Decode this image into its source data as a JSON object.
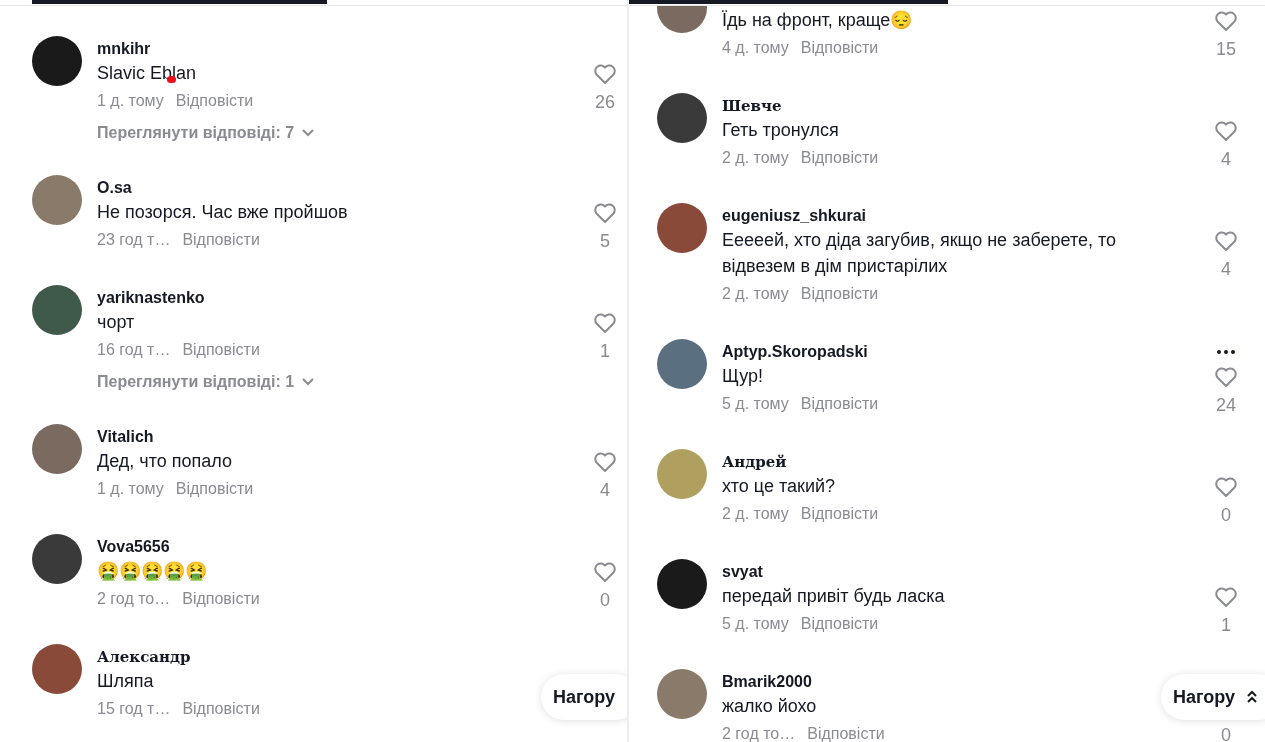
{
  "panels": [
    {
      "scroll_top_button": {
        "label": "Нагору",
        "chevron": false
      },
      "comments": [
        {
          "username": "mnkihr",
          "serif_name": false,
          "text": "Slavic Eblan",
          "censor_mark": true,
          "time": "1 д. тому",
          "reply": "Відповісти",
          "likes": "26",
          "view_replies": "Переглянути відповіді: 7"
        },
        {
          "username": "O.sa",
          "serif_name": false,
          "text": "Не позорся. Час вже пройшов",
          "censor_mark": false,
          "time": "23 год т…",
          "reply": "Відповісти",
          "likes": "5"
        },
        {
          "username": "yariknastenko",
          "serif_name": false,
          "text": "чорт",
          "censor_mark": false,
          "time": "16 год т…",
          "reply": "Відповісти",
          "likes": "1",
          "view_replies": "Переглянути відповіді: 1"
        },
        {
          "username": "Vitalich",
          "serif_name": false,
          "text": "Дед, что попало",
          "censor_mark": false,
          "time": "1 д. тому",
          "reply": "Відповісти",
          "likes": "4"
        },
        {
          "username": "Vova5656",
          "serif_name": false,
          "text": "🤮🤮🤮🤮🤮",
          "censor_mark": false,
          "time": "2 год то…",
          "reply": "Відповісти",
          "likes": "0"
        },
        {
          "username": "Александр",
          "serif_name": true,
          "text": "Шляпа",
          "censor_mark": false,
          "time": "15 год т…",
          "reply": "Відповісти"
        }
      ]
    },
    {
      "scroll_top_button": {
        "label": "Нагору",
        "chevron": true
      },
      "comments": [
        {
          "text": "Їдь на фронт, краще😔",
          "censor_mark": false,
          "time": "4 д. тому",
          "reply": "Відповісти",
          "likes": "15"
        },
        {
          "username": "Шевче",
          "serif_name": true,
          "text": "Геть тронулся",
          "censor_mark": false,
          "time": "2 д. тому",
          "reply": "Відповісти",
          "likes": "4"
        },
        {
          "username": "eugeniusz_shkurai",
          "serif_name": false,
          "text": "Ееееей, хто діда загубив, якщо не заберете, то відвезем в дім пристарілих",
          "censor_mark": false,
          "time": "2 д. тому",
          "reply": "Відповісти",
          "likes": "4"
        },
        {
          "username": "Aptyp.Skoropadski",
          "serif_name": false,
          "text": "Щур!",
          "censor_mark": false,
          "time": "5 д. тому",
          "reply": "Відповісти",
          "likes": "24",
          "more_menu": true
        },
        {
          "username": "Андрей",
          "serif_name": true,
          "text": "хто це такий?",
          "censor_mark": false,
          "time": "2 д. тому",
          "reply": "Відповісти",
          "likes": "0"
        },
        {
          "username": "svyat",
          "serif_name": false,
          "text": "передай привіт будь ласка",
          "censor_mark": false,
          "time": "5 д. тому",
          "reply": "Відповісти",
          "likes": "1"
        },
        {
          "username": "Bmarik2000",
          "serif_name": false,
          "text": "жалко йохо",
          "censor_mark": false,
          "time": "2 год то…",
          "reply": "Відповісти",
          "likes": "0"
        }
      ]
    }
  ]
}
